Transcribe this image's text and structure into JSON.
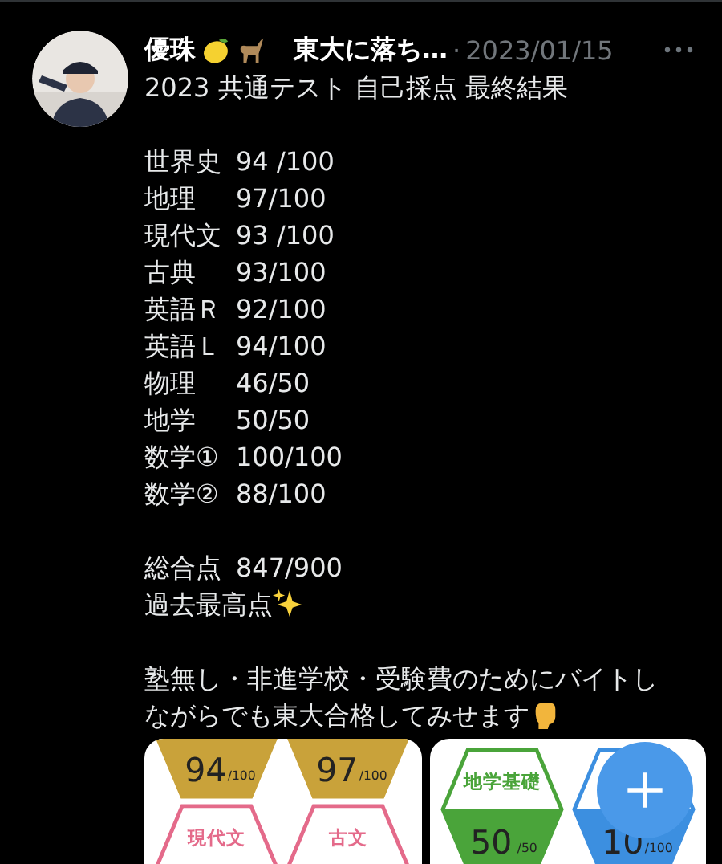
{
  "post": {
    "author": "優珠",
    "author_trail": "東大に落ち…",
    "separator": "·",
    "date": "2023/01/15",
    "title": "2023 共通テスト 自己採点 最終結果",
    "scores": [
      {
        "subject": "世界史",
        "score": "94 /100"
      },
      {
        "subject": "地理",
        "score": "97/100"
      },
      {
        "subject": "現代文",
        "score": "93 /100"
      },
      {
        "subject": "古典",
        "score": "93/100"
      },
      {
        "subject": "英語Ｒ",
        "score": "92/100"
      },
      {
        "subject": "英語Ｌ",
        "score": "94/100"
      },
      {
        "subject": "物理",
        "score": "46/50"
      },
      {
        "subject": "地学",
        "score": "50/50"
      },
      {
        "subject": "数学①",
        "score": "100/100"
      },
      {
        "subject": "数学②",
        "score": "88/100"
      }
    ],
    "total": {
      "subject": "総合点",
      "score": "847/900"
    },
    "note": "過去最高点",
    "message_lines": [
      "塾無し・非進学校・受験費のためにバイトし",
      "ながらでも東大合格してみせます"
    ]
  },
  "images": [
    {
      "badges": [
        {
          "value": "94",
          "max": "/100",
          "color": "#c9a23a"
        },
        {
          "value": "97",
          "max": "/100",
          "color": "#c9a23a"
        },
        {
          "label": "現代文",
          "color": "#e46a8a"
        },
        {
          "label": "古文",
          "color": "#e46a8a"
        }
      ]
    },
    {
      "badges": [
        {
          "label": "地学基礎",
          "value": "50",
          "max": "/50",
          "color": "#4aa43a"
        },
        {
          "value": "10",
          "max": "/100",
          "color": "#3c8fe0"
        }
      ]
    }
  ]
}
